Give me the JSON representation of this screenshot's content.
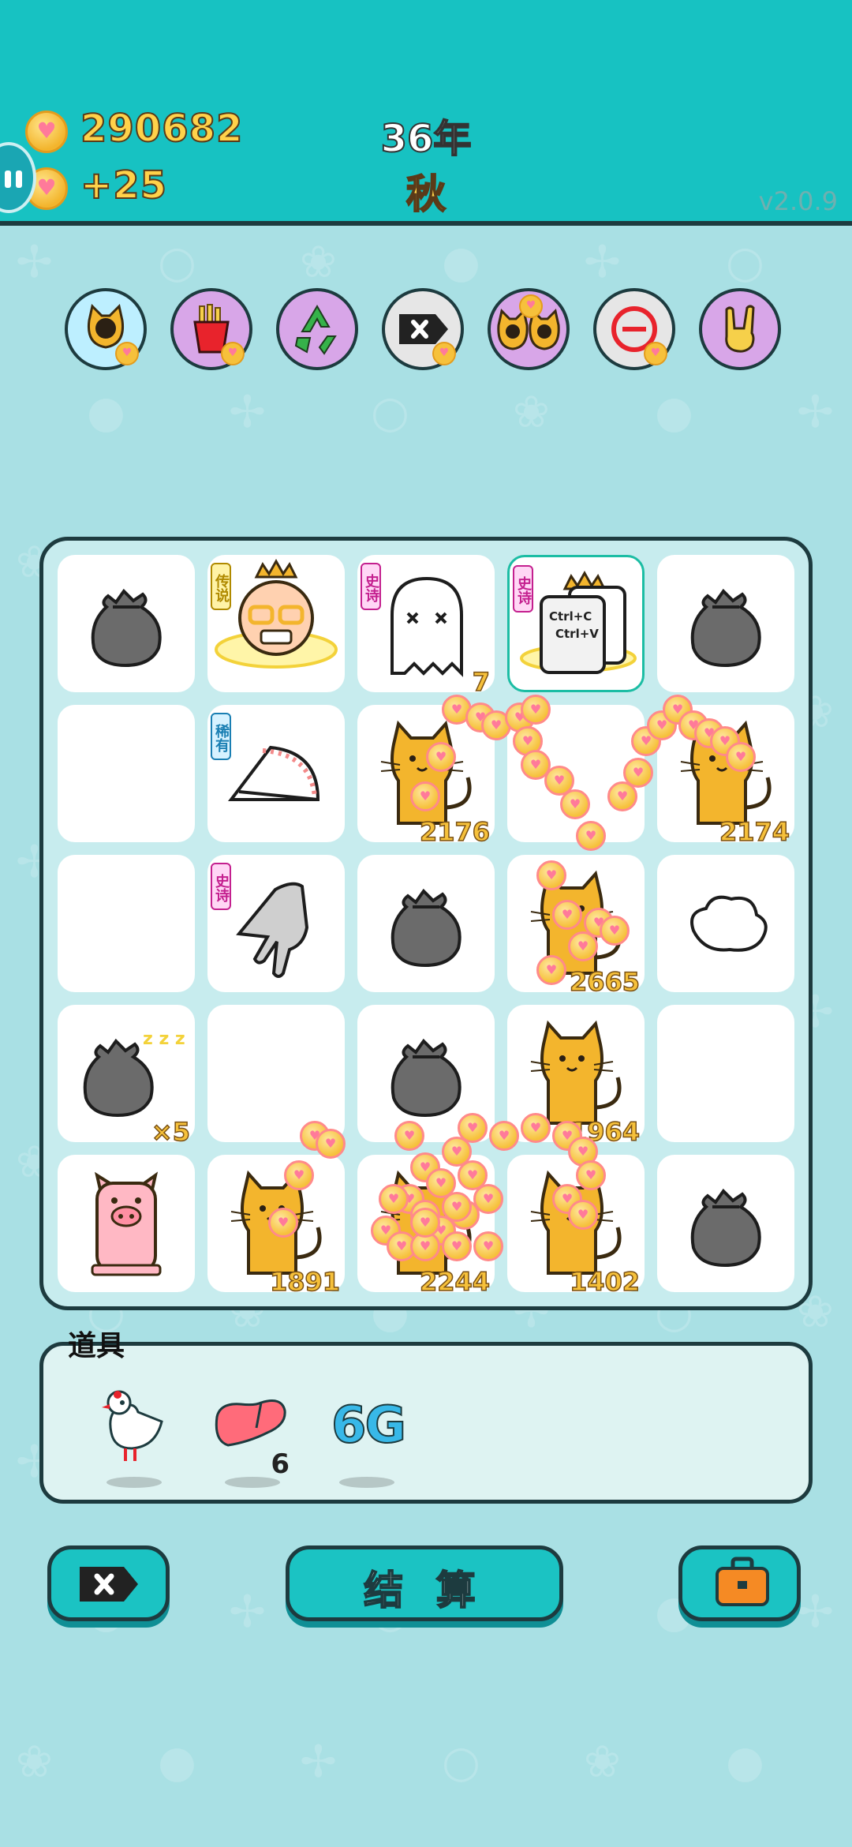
{
  "header": {
    "coins": "290682",
    "coins_per_turn": "+25",
    "year": "36年",
    "season": "秋",
    "version": "v2.0.9"
  },
  "skills": [
    {
      "icon": "cat-face-icon",
      "bg": "#bdefff"
    },
    {
      "icon": "fries-icon",
      "bg": "#d8a6e8"
    },
    {
      "icon": "recycle-icon",
      "bg": "#d8a6e8"
    },
    {
      "icon": "remove-tag-icon",
      "bg": "#e6e6e6"
    },
    {
      "icon": "twin-cats-icon",
      "bg": "#d8a6e8"
    },
    {
      "icon": "minus-circle-icon",
      "bg": "#e6e6e6"
    },
    {
      "icon": "rock-hand-icon",
      "bg": "#d8a6e8"
    }
  ],
  "board": {
    "rows": [
      [
        {
          "item": "trash-bag",
          "badge": "",
          "value": ""
        },
        {
          "item": "king-face",
          "badge": "传说",
          "value": ""
        },
        {
          "item": "ghost",
          "badge": "史诗",
          "value": "7"
        },
        {
          "item": "ctrl-c-v-card",
          "badge": "史诗",
          "value": "",
          "card_text_1": "Ctrl+C",
          "card_text_2": "Ctrl+V"
        },
        {
          "item": "trash-bag",
          "badge": "",
          "value": ""
        }
      ],
      [
        {
          "item": "empty",
          "badge": "",
          "value": ""
        },
        {
          "item": "speed-gauge",
          "badge": "稀有",
          "value": ""
        },
        {
          "item": "cat",
          "badge": "",
          "value": "2176"
        },
        {
          "item": "empty",
          "badge": "",
          "value": ""
        },
        {
          "item": "cat",
          "badge": "",
          "value": "2174"
        }
      ],
      [
        {
          "item": "empty",
          "badge": "",
          "value": ""
        },
        {
          "item": "pointing-hand",
          "badge": "史诗",
          "value": ""
        },
        {
          "item": "trash-bag",
          "badge": "",
          "value": ""
        },
        {
          "item": "cat",
          "badge": "",
          "value": "2665"
        },
        {
          "item": "cloud-puff",
          "badge": "",
          "value": ""
        }
      ],
      [
        {
          "item": "sleeping-trash-bag",
          "badge": "",
          "value": "×5"
        },
        {
          "item": "empty",
          "badge": "",
          "value": ""
        },
        {
          "item": "trash-bag",
          "badge": "",
          "value": ""
        },
        {
          "item": "cat",
          "badge": "",
          "value": "1964"
        },
        {
          "item": "empty",
          "badge": "",
          "value": ""
        }
      ],
      [
        {
          "item": "pig",
          "badge": "",
          "value": ""
        },
        {
          "item": "cat",
          "badge": "",
          "value": "1891"
        },
        {
          "item": "cat",
          "badge": "",
          "value": "2244"
        },
        {
          "item": "cat",
          "badge": "",
          "value": "1402"
        },
        {
          "item": "trash-bag",
          "badge": "",
          "value": ""
        }
      ]
    ]
  },
  "tools": {
    "label": "道具",
    "items": [
      {
        "icon": "white-bird-icon",
        "count": ""
      },
      {
        "icon": "liver-icon",
        "count": "6"
      },
      {
        "icon": "6g-icon",
        "text": "6G",
        "count": ""
      }
    ]
  },
  "buttons": {
    "settle_label": "结 算"
  },
  "colors": {
    "header_bg": "#17c2c2",
    "page_bg": "#a9e0e4",
    "coin": "#f6c13b",
    "outline": "#1d3b3f",
    "button": "#1bc3c3"
  }
}
